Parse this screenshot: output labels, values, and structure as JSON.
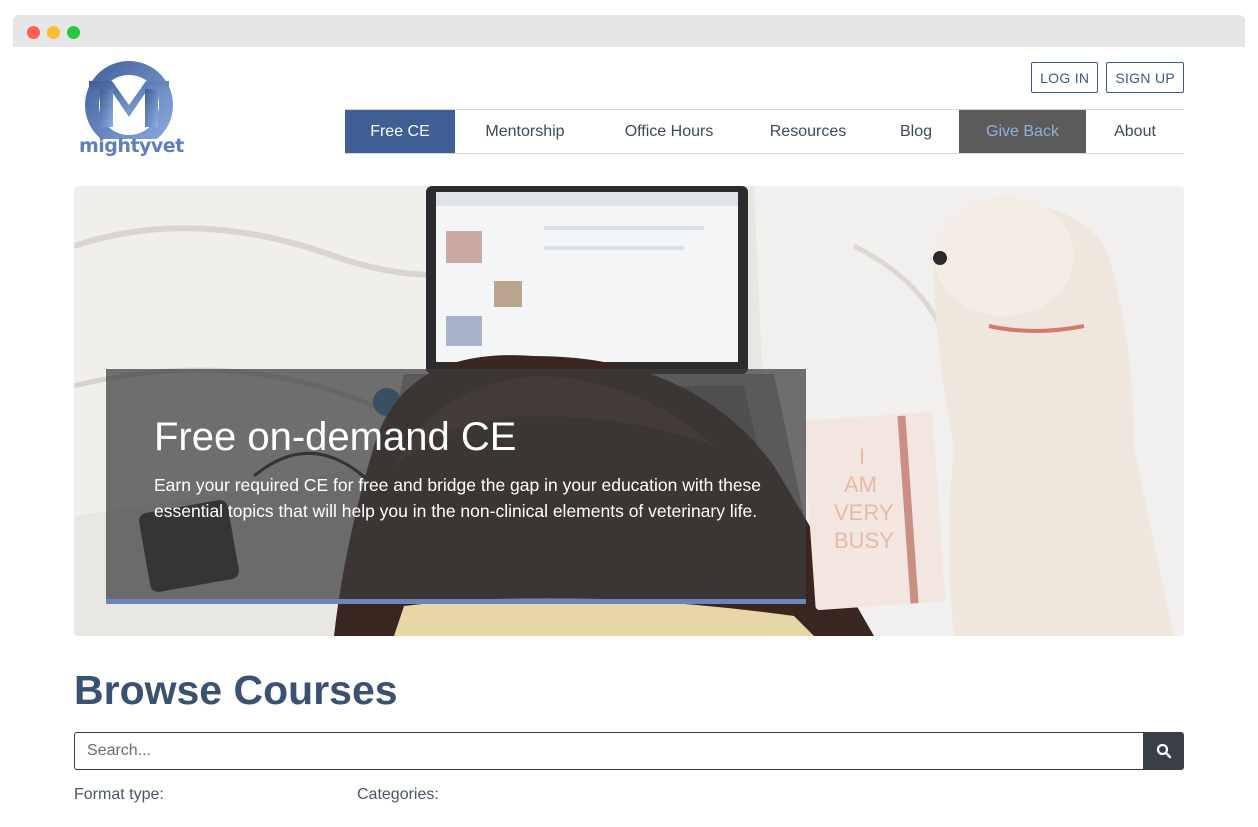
{
  "logo": {
    "text": "mightyvet"
  },
  "auth": {
    "login": "LOG IN",
    "signup": "SIGN UP"
  },
  "nav": {
    "items": [
      {
        "label": "Free CE"
      },
      {
        "label": "Mentorship"
      },
      {
        "label": "Office Hours"
      },
      {
        "label": "Resources"
      },
      {
        "label": "Blog"
      },
      {
        "label": "Give Back"
      },
      {
        "label": "About"
      }
    ],
    "active": "Free CE"
  },
  "hero": {
    "title": "Free on-demand CE",
    "description": "Earn your required CE for free and bridge the gap in your education with these essential topics that will help you in the non-clinical elements of veterinary life.",
    "notebook_text": "I AM VERY BUSY"
  },
  "browse": {
    "heading": "Browse Courses",
    "search_placeholder": "Search...",
    "format_label": "Format type:",
    "categories_label": "Categories:"
  },
  "colors": {
    "brand_blue": "#3f5e93",
    "give_back_bg": "#5b5b5b",
    "heading": "#3a5170",
    "accent_bar": "#6f84bf"
  },
  "icons": {
    "search": "search-icon",
    "logo": "mightyvet-logo-icon"
  }
}
